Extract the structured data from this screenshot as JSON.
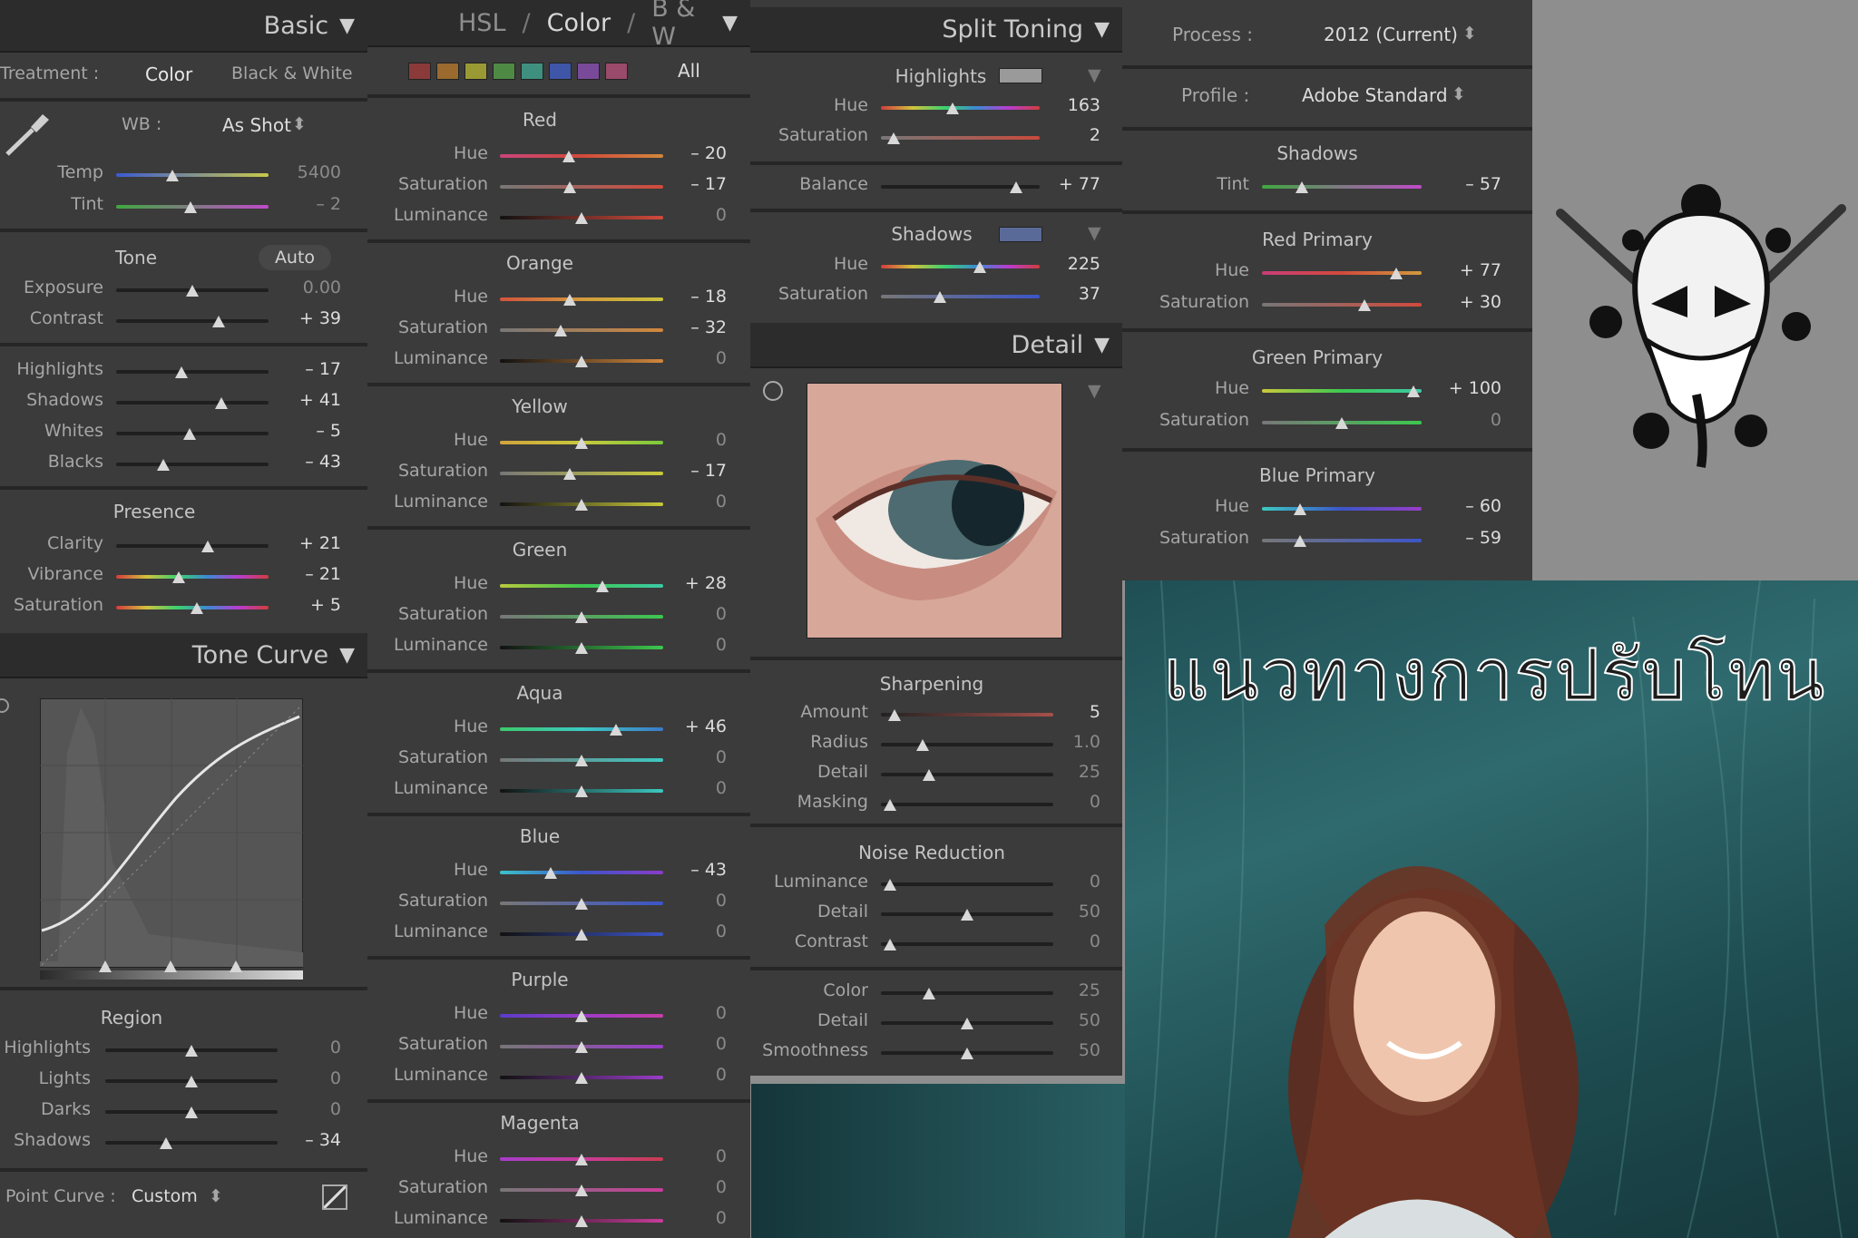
{
  "basic": {
    "title": "Basic",
    "treatment_label": "Treatment :",
    "treatment_color": "Color",
    "treatment_bw": "Black & White",
    "wb_label": "WB :",
    "wb_value": "As Shot",
    "temp": {
      "label": "Temp",
      "value": "5400",
      "pos": 0.37
    },
    "tint": {
      "label": "Tint",
      "value": "– 2",
      "pos": 0.49
    },
    "tone_title": "Tone",
    "auto_label": "Auto",
    "exposure": {
      "label": "Exposure",
      "value": "0.00",
      "pos": 0.5
    },
    "contrast": {
      "label": "Contrast",
      "value": "+ 39",
      "pos": 0.67
    },
    "highlights": {
      "label": "Highlights",
      "value": "– 17",
      "pos": 0.43
    },
    "shadows": {
      "label": "Shadows",
      "value": "+ 41",
      "pos": 0.69
    },
    "whites": {
      "label": "Whites",
      "value": "– 5",
      "pos": 0.48
    },
    "blacks": {
      "label": "Blacks",
      "value": "– 43",
      "pos": 0.31
    },
    "presence_title": "Presence",
    "clarity": {
      "label": "Clarity",
      "value": "+ 21",
      "pos": 0.6
    },
    "vibrance": {
      "label": "Vibrance",
      "value": "– 21",
      "pos": 0.41
    },
    "saturation": {
      "label": "Saturation",
      "value": "+ 5",
      "pos": 0.53
    }
  },
  "tone_curve": {
    "title": "Tone Curve",
    "region_title": "Region",
    "highlights": {
      "label": "Highlights",
      "value": "0",
      "pos": 0.5
    },
    "lights": {
      "label": "Lights",
      "value": "0",
      "pos": 0.5
    },
    "darks": {
      "label": "Darks",
      "value": "0",
      "pos": 0.5
    },
    "shadows": {
      "label": "Shadows",
      "value": "– 34",
      "pos": 0.35
    },
    "point_curve_label": "Point Curve :",
    "point_curve_value": "Custom"
  },
  "hsl": {
    "tab_hsl": "HSL",
    "tab_color": "Color",
    "tab_bw": "B & W",
    "all_label": "All",
    "swatches": [
      "#8b3a3a",
      "#9a6a2e",
      "#9a9a34",
      "#4f8a45",
      "#3f8f7f",
      "#3f55a8",
      "#7a4a9a",
      "#9a4a6a"
    ],
    "hue_label": "Hue",
    "saturation_label": "Saturation",
    "luminance_label": "Luminance",
    "groups": [
      {
        "name": "Red",
        "hue": "– 20",
        "sat": "– 17",
        "lum": "0",
        "hp": 0.42,
        "sp": 0.43,
        "lp": 0.5
      },
      {
        "name": "Orange",
        "hue": "– 18",
        "sat": "– 32",
        "lum": "0",
        "hp": 0.43,
        "sp": 0.37,
        "lp": 0.5
      },
      {
        "name": "Yellow",
        "hue": "0",
        "sat": "– 17",
        "lum": "0",
        "hp": 0.5,
        "sp": 0.43,
        "lp": 0.5
      },
      {
        "name": "Green",
        "hue": "+ 28",
        "sat": "0",
        "lum": "0",
        "hp": 0.63,
        "sp": 0.5,
        "lp": 0.5
      },
      {
        "name": "Aqua",
        "hue": "+ 46",
        "sat": "0",
        "lum": "0",
        "hp": 0.71,
        "sp": 0.5,
        "lp": 0.5
      },
      {
        "name": "Blue",
        "hue": "– 43",
        "sat": "0",
        "lum": "0",
        "hp": 0.31,
        "sp": 0.5,
        "lp": 0.5
      },
      {
        "name": "Purple",
        "hue": "0",
        "sat": "0",
        "lum": "0",
        "hp": 0.5,
        "sp": 0.5,
        "lp": 0.5
      },
      {
        "name": "Magenta",
        "hue": "0",
        "sat": "0",
        "lum": "0",
        "hp": 0.5,
        "sp": 0.5,
        "lp": 0.5
      }
    ]
  },
  "split_toning": {
    "title": "Split Toning",
    "highlights_title": "Highlights",
    "hl_hue": {
      "label": "Hue",
      "value": "163",
      "pos": 0.45
    },
    "hl_sat": {
      "label": "Saturation",
      "value": "2",
      "pos": 0.08
    },
    "balance": {
      "label": "Balance",
      "value": "+ 77",
      "pos": 0.85
    },
    "shadows_title": "Shadows",
    "sh_hue": {
      "label": "Hue",
      "value": "225",
      "pos": 0.62
    },
    "sh_sat": {
      "label": "Saturation",
      "value": "37",
      "pos": 0.37
    },
    "highlight_swatch": "#9a9a9a",
    "shadow_swatch": "#5a6a98"
  },
  "detail": {
    "title": "Detail",
    "sharpening_title": "Sharpening",
    "amount": {
      "label": "Amount",
      "value": "5",
      "pos": 0.08
    },
    "radius": {
      "label": "Radius",
      "value": "1.0",
      "pos": 0.24
    },
    "detail": {
      "label": "Detail",
      "value": "25",
      "pos": 0.28
    },
    "masking": {
      "label": "Masking",
      "value": "0",
      "pos": 0.05
    },
    "noise_title": "Noise Reduction",
    "luminance": {
      "label": "Luminance",
      "value": "0",
      "pos": 0.05
    },
    "nr_detail": {
      "label": "Detail",
      "value": "50",
      "pos": 0.5
    },
    "nr_contrast": {
      "label": "Contrast",
      "value": "0",
      "pos": 0.05
    },
    "color": {
      "label": "Color",
      "value": "25",
      "pos": 0.28
    },
    "color_detail": {
      "label": "Detail",
      "value": "50",
      "pos": 0.5
    },
    "smoothness": {
      "label": "Smoothness",
      "value": "50",
      "pos": 0.5
    }
  },
  "calibration": {
    "process_label": "Process :",
    "process_value": "2012 (Current)",
    "profile_label": "Profile :",
    "profile_value": "Adobe Standard",
    "shadows_title": "Shadows",
    "tint": {
      "label": "Tint",
      "value": "– 57",
      "pos": 0.25
    },
    "red_title": "Red Primary",
    "red_hue": {
      "label": "Hue",
      "value": "+ 77",
      "pos": 0.84
    },
    "red_sat": {
      "label": "Saturation",
      "value": "+ 30",
      "pos": 0.64
    },
    "green_title": "Green Primary",
    "green_hue": {
      "label": "Hue",
      "value": "+ 100",
      "pos": 0.95
    },
    "green_sat": {
      "label": "Saturation",
      "value": "0",
      "pos": 0.5
    },
    "blue_title": "Blue Primary",
    "blue_hue": {
      "label": "Hue",
      "value": "– 60",
      "pos": 0.24
    },
    "blue_sat": {
      "label": "Saturation",
      "value": "– 59",
      "pos": 0.24
    }
  },
  "overlay_text": "แนวทางการปรับโทน"
}
